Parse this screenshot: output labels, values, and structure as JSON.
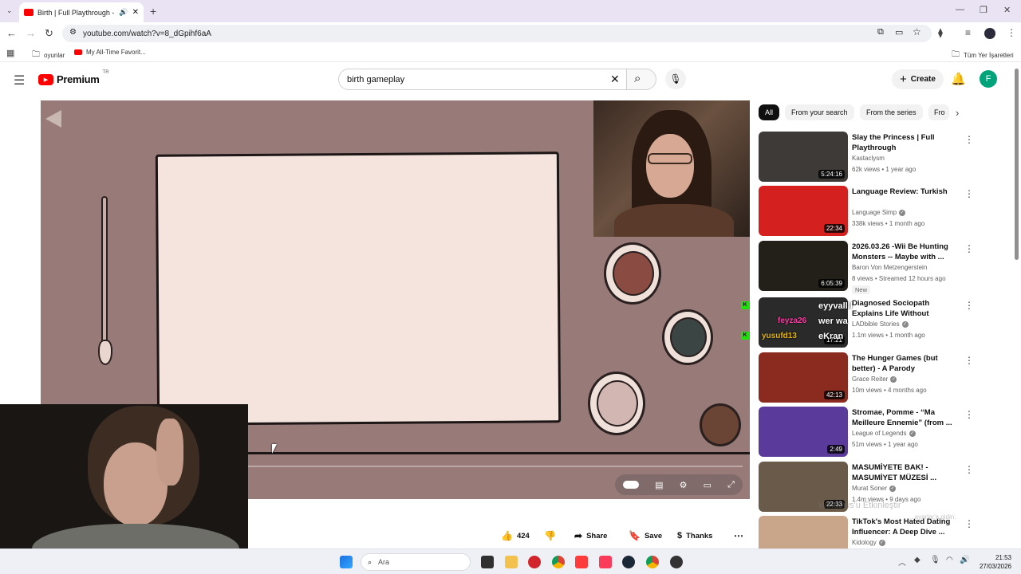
{
  "browser": {
    "tab_title": "Birth | Full Playthrough - YouTube",
    "new_tab": "+",
    "url": "youtube.com/watch?v=8_dGpihf6aA",
    "bookmarks": [
      "oyunlar",
      "My All-Time Favorit..."
    ],
    "all_bookmarks": "Tüm Yer İşaretleri"
  },
  "youtube": {
    "logo_text": "Premium",
    "logo_region": "TR",
    "search_value": "birth gameplay",
    "create_label": "Create",
    "avatar_letter": "F"
  },
  "chips": [
    "All",
    "From your search",
    "From the series",
    "Fro"
  ],
  "recommendations": [
    {
      "title": "Slay the Princess | Full Playthrough",
      "channel": "Kastaclysm",
      "verified": false,
      "meta": "62k views • 1 year ago",
      "duration": "5:24:16",
      "badge": "",
      "thumb_color": "#3d3a38"
    },
    {
      "title": "Language Review: Turkish",
      "channel": "Language Simp",
      "verified": true,
      "meta": "338k views • 1 month ago",
      "duration": "22:34",
      "badge": "",
      "thumb_color": "#d52020"
    },
    {
      "title": "2026.03.26 -Wii Be Hunting Monsters -- Maybe with ...",
      "channel": "Baron Von Metzengerstein",
      "verified": false,
      "meta": "8 views • Streamed 12 hours ago",
      "duration": "6:05:39",
      "badge": "New",
      "thumb_color": "#222018"
    },
    {
      "title": "Diagnosed Sociopath Explains Life Without Empathy, Guilt or ...",
      "channel": "LADbible Stories",
      "verified": true,
      "meta": "1.1m views • 1 month ago",
      "duration": "17:21",
      "badge": "",
      "thumb_color": "#2a2a2a"
    },
    {
      "title": "The Hunger Games (but better) - A Parody",
      "channel": "Grace Reiter",
      "verified": true,
      "meta": "10m views • 4 months ago",
      "duration": "42:13",
      "badge": "",
      "thumb_color": "#8b2a1e"
    },
    {
      "title": "Stromae, Pomme - “Ma Meilleure Ennemie” (from ...",
      "channel": "League of Legends",
      "verified": true,
      "meta": "51m views • 1 year ago",
      "duration": "2:49",
      "badge": "",
      "thumb_color": "#5a3a9a"
    },
    {
      "title": "MASUMİYETE BAK! - MASUMİYET MÜZESİ ...",
      "channel": "Murat Soner",
      "verified": true,
      "meta": "1.4m views • 9 days ago",
      "duration": "22:33",
      "badge": "",
      "thumb_color": "#6a5a4a"
    },
    {
      "title": "TikTok's Most Hated Dating Influencer: A Deep Dive ...",
      "channel": "Kidology",
      "verified": true,
      "meta": "",
      "duration": "",
      "badge": "",
      "thumb_color": "#c9a58a"
    }
  ],
  "actions": {
    "likes": "424",
    "share": "Share",
    "save": "Save",
    "thanks": "Thanks"
  },
  "overlay": {
    "chat_lines": [
      "eyyvallll",
      "wer wa",
      "eKran"
    ],
    "chat_names": [
      "feyza26",
      "yusufd13"
    ],
    "watermark": "Windows'u Etkinleştir",
    "watermark_sub": "...ayarlar'a gidin."
  },
  "taskbar": {
    "search_placeholder": "Ara",
    "time": "21:53",
    "date": "27/03/2026"
  },
  "colors": {
    "yt_red": "#ff0000",
    "player_bg": "#987a79",
    "avatar": "#00a37a",
    "chat_green": "#1fe00a"
  }
}
